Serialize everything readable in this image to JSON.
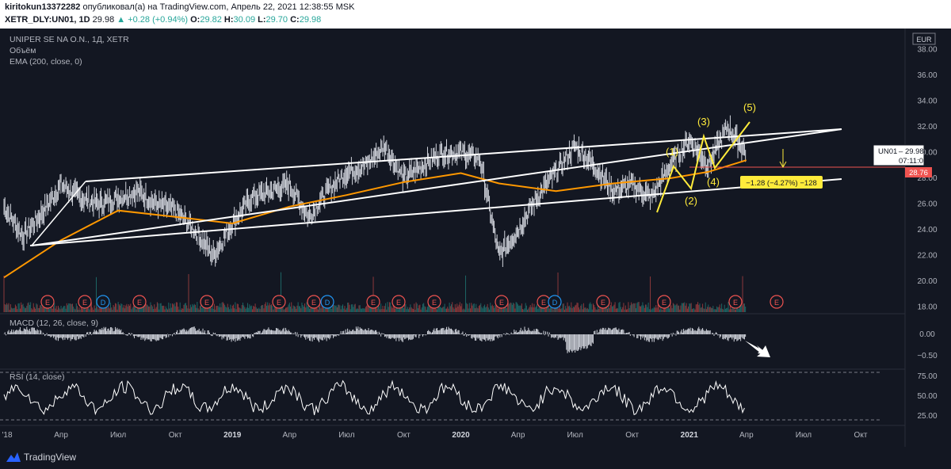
{
  "header": {
    "user": "kiritokun13372282",
    "published": "опубликовал(а) на TradingView.com, Апрель 22, 2021 12:38:55 MSK",
    "symbol": "XETR_DLY:UN01, 1D",
    "price": "29.98",
    "change": "▲ +0.28 (+0.94%)",
    "o_label": "O:",
    "o": "29.82",
    "h_label": "H:",
    "h": "30.09",
    "l_label": "L:",
    "l": "29.70",
    "c_label": "C:",
    "c": "29.98"
  },
  "legend": {
    "title": "UNIPER SE NA O.N., 1Д, XETR",
    "volume": "Объём",
    "ema": "EMA (200, close, 0)",
    "macd": "MACD (12, 26, close, 9)",
    "rsi": "RSI (14, close)"
  },
  "currency": "EUR",
  "price_tag": {
    "symbol": "UN01",
    "value": "29.98",
    "timer": "07:11:07"
  },
  "red_tag": "28.76",
  "measure_label": "−1.28 (−4.27%) −128",
  "brand": "TradingView",
  "colors": {
    "bg": "#131722",
    "up": "#26a69a",
    "down": "#ef5350",
    "ema": "#ff9800",
    "waves": "#ffeb3b",
    "channel": "#ffffff"
  },
  "chart_data": [
    {
      "type": "line",
      "title": "UNIPER SE NA O.N., 1Д, XETR",
      "x_ticks": [
        "'18",
        "Апр",
        "Июл",
        "Окт",
        "2019",
        "Апр",
        "Июл",
        "Окт",
        "2020",
        "Апр",
        "Июл",
        "Окт",
        "2021",
        "Апр",
        "Июл",
        "Окт"
      ],
      "y_ticks": [
        "38.00",
        "36.00",
        "34.00",
        "32.00",
        "30.00",
        "28.00",
        "26.00",
        "24.00",
        "22.00",
        "20.00",
        "18.00"
      ],
      "ylim": [
        17,
        39
      ],
      "series": [
        {
          "name": "UN01",
          "x": [
            "2018-01",
            "2018-02",
            "2018-03",
            "2018-04",
            "2018-05",
            "2018-06",
            "2018-07",
            "2018-08",
            "2018-09",
            "2018-10",
            "2018-11",
            "2018-12",
            "2019-01",
            "2019-02",
            "2019-03",
            "2019-04",
            "2019-05",
            "2019-06",
            "2019-07",
            "2019-08",
            "2019-09",
            "2019-10",
            "2019-11",
            "2019-12",
            "2020-01",
            "2020-02",
            "2020-03",
            "2020-04",
            "2020-05",
            "2020-06",
            "2020-07",
            "2020-08",
            "2020-09",
            "2020-10",
            "2020-11",
            "2020-12",
            "2021-01",
            "2021-02",
            "2021-03",
            "2021-04"
          ],
          "values": [
            25.8,
            23.5,
            25.3,
            27.5,
            26.5,
            26.0,
            26.5,
            27.0,
            26.0,
            25.5,
            24.0,
            22.0,
            24.5,
            26.5,
            27.0,
            27.5,
            25.0,
            27.0,
            28.5,
            29.0,
            30.5,
            28.0,
            29.0,
            30.0,
            30.0,
            29.5,
            22.0,
            24.0,
            26.5,
            28.5,
            30.5,
            29.0,
            27.0,
            27.5,
            26.5,
            29.0,
            31.0,
            29.0,
            32.0,
            29.98
          ]
        },
        {
          "name": "EMA (200, close, 0)",
          "x": [
            "2018-01",
            "2018-04",
            "2018-07",
            "2018-10",
            "2019-01",
            "2019-04",
            "2019-07",
            "2019-10",
            "2020-01",
            "2020-03",
            "2020-06",
            "2020-09",
            "2020-12",
            "2021-02",
            "2021-04"
          ],
          "values": [
            20.3,
            23.2,
            25.5,
            25.0,
            24.5,
            25.8,
            26.7,
            27.7,
            28.4,
            27.6,
            27.0,
            27.6,
            28.0,
            28.5,
            29.4
          ]
        }
      ],
      "annotations": [
        "(1)",
        "(2)",
        "(3)",
        "(4)",
        "(5)"
      ]
    },
    {
      "type": "line",
      "title": "MACD (12, 26, close, 9)",
      "y_ticks": [
        "0.00",
        "−0.50"
      ],
      "ylim": [
        -0.6,
        0.3
      ]
    },
    {
      "type": "line",
      "title": "RSI (14, close)",
      "y_ticks": [
        "75.00",
        "50.00",
        "25.00"
      ],
      "ylim": [
        20,
        85
      ],
      "bands": [
        70,
        30
      ]
    }
  ]
}
